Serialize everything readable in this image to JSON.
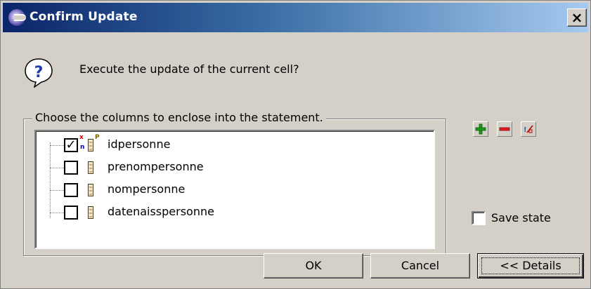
{
  "dialog": {
    "title": "Confirm Update",
    "close_label": "×",
    "prompt": "Execute the update of the current cell?"
  },
  "columns_group": {
    "legend": "Choose the columns to enclose into the statement.",
    "items": [
      {
        "label": "idpersonne",
        "checked": true,
        "primary_key_marks": [
          "x",
          "n",
          "P"
        ]
      },
      {
        "label": "prenompersonne",
        "checked": false
      },
      {
        "label": "nompersonne",
        "checked": false
      },
      {
        "label": "datenaisspersonne",
        "checked": false
      }
    ]
  },
  "toolbar": {
    "add_icon": "green-plus-icon",
    "remove_icon": "red-minus-icon",
    "toggle_icon": "toggle-selection-icon"
  },
  "save_state": {
    "label": "Save state",
    "checked": false
  },
  "buttons": {
    "ok": "OK",
    "cancel": "Cancel",
    "details": "<< Details"
  },
  "colors": {
    "titlebar_start": "#0a246a",
    "titlebar_end": "#a6caf0",
    "dialog_bg": "#d4d0c8"
  }
}
